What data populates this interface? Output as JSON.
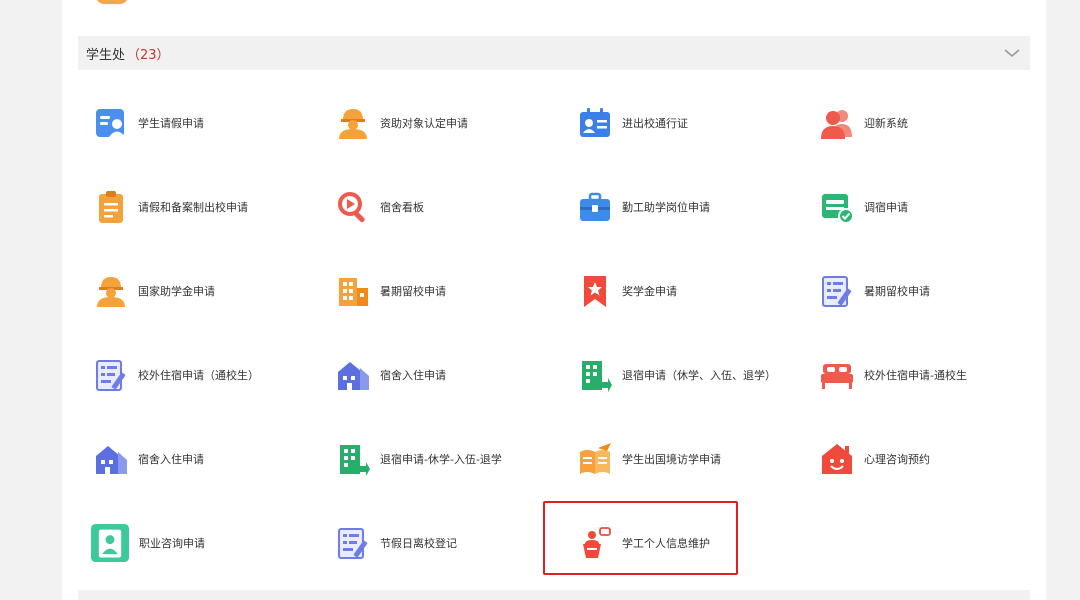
{
  "section": {
    "title": "学生处",
    "count": "（23）"
  },
  "apps": [
    {
      "label": "学生请假申请",
      "icon": "person-card-icon"
    },
    {
      "label": "资助对象认定申请",
      "icon": "worker-icon"
    },
    {
      "label": "进出校通行证",
      "icon": "id-card-icon"
    },
    {
      "label": "迎新系统",
      "icon": "users-icon"
    },
    {
      "label": "请假和备案制出校申请",
      "icon": "clipboard-icon"
    },
    {
      "label": "宿舍看板",
      "icon": "search-play-icon"
    },
    {
      "label": "勤工助学岗位申请",
      "icon": "briefcase-icon"
    },
    {
      "label": "调宿申请",
      "icon": "bed-check-icon"
    },
    {
      "label": "国家助学金申请",
      "icon": "worker-icon"
    },
    {
      "label": "暑期留校申请",
      "icon": "building-icon"
    },
    {
      "label": "奖学金申请",
      "icon": "ribbon-star-icon"
    },
    {
      "label": "暑期留校申请",
      "icon": "form-pen-icon"
    },
    {
      "label": "校外住宿申请（通校生）",
      "icon": "form-pen-icon"
    },
    {
      "label": "宿舍入住申请",
      "icon": "houses-icon"
    },
    {
      "label": "退宿申请（休学、入伍、退学）",
      "icon": "building-exit-icon"
    },
    {
      "label": "校外住宿申请-通校生",
      "icon": "bed-icon"
    },
    {
      "label": "宿舍入住申请",
      "icon": "houses-icon"
    },
    {
      "label": "退宿申请-休学-入伍-退学",
      "icon": "building-exit-icon"
    },
    {
      "label": "学生出国境访学申请",
      "icon": "book-plane-icon"
    },
    {
      "label": "心理咨询预约",
      "icon": "smile-house-icon"
    },
    {
      "label": "职业咨询申请",
      "icon": "career-icon"
    },
    {
      "label": "节假日离校登记",
      "icon": "form-pen-icon"
    },
    {
      "label": "学工个人信息维护",
      "icon": "speaker-podium-icon"
    }
  ],
  "colors": {
    "accent_red": "#e02020",
    "count_red": "#c0392b"
  }
}
